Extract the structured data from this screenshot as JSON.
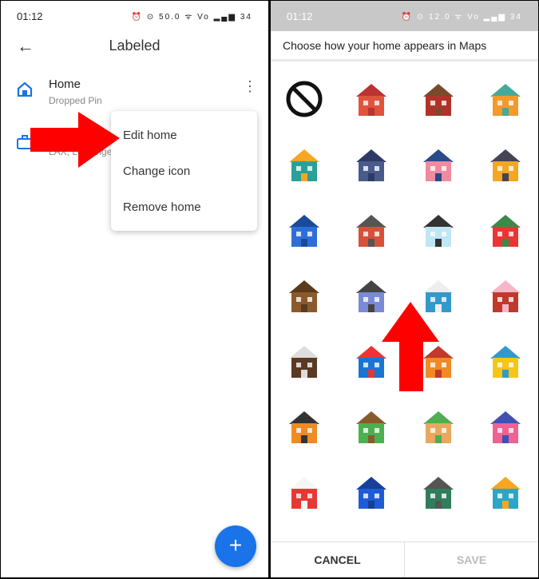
{
  "left": {
    "status": {
      "time": "01:12",
      "icons": "⏰ ⊙ 50.0 ᯤ Vo ▂▄▆ 34"
    },
    "title": "Labeled",
    "items": [
      {
        "name": "Home",
        "sub": "Dropped Pin",
        "icon": "home-icon"
      },
      {
        "name": "",
        "sub": "LAX, Los Angel",
        "icon": "briefcase-icon"
      }
    ],
    "menu": [
      "Edit home",
      "Change icon",
      "Remove home"
    ],
    "fab": "+"
  },
  "right": {
    "status": {
      "time": "01:12",
      "icons": "⏰ ⊙ 12.0 ᯤ Vo ▂▄▆ 34"
    },
    "heading": "Choose how your home appears in Maps",
    "icons": [
      {
        "name": "none",
        "c1": "#111",
        "c2": "#fff"
      },
      {
        "name": "brick-apartment",
        "c1": "#e0533c",
        "c2": "#b33"
      },
      {
        "name": "barn",
        "c1": "#b0332a",
        "c2": "#7a4b2a"
      },
      {
        "name": "orange-shop",
        "c1": "#f39a2b",
        "c2": "#4a9"
      },
      {
        "name": "camper-van",
        "c1": "#2aa198",
        "c2": "#f5a623"
      },
      {
        "name": "castle",
        "c1": "#4a5a8a",
        "c2": "#2e3a66"
      },
      {
        "name": "pink-house",
        "c1": "#f08aa0",
        "c2": "#2b4a8a"
      },
      {
        "name": "construction-crane",
        "c1": "#f5a623",
        "c2": "#445"
      },
      {
        "name": "skyscraper",
        "c1": "#2d6fd6",
        "c2": "#1a4a9a"
      },
      {
        "name": "red-house",
        "c1": "#d8503a",
        "c2": "#555"
      },
      {
        "name": "igloo",
        "c1": "#bfe6f5",
        "c2": "#333"
      },
      {
        "name": "lighthouse",
        "c1": "#e33",
        "c2": "#3a8a4a"
      },
      {
        "name": "log-cabin",
        "c1": "#8b5a2b",
        "c2": "#5a3a1a"
      },
      {
        "name": "modern-building",
        "c1": "#7a8ad6",
        "c2": "#444"
      },
      {
        "name": "modern-store",
        "c1": "#39c",
        "c2": "#eee"
      },
      {
        "name": "pagoda",
        "c1": "#c0392b",
        "c2": "#f7b6c8"
      },
      {
        "name": "pirate-ship",
        "c1": "#5a3a22",
        "c2": "#ddd"
      },
      {
        "name": "sailboat",
        "c1": "#1a75d2",
        "c2": "#e33"
      },
      {
        "name": "schoolhouse",
        "c1": "#f08a24",
        "c2": "#c0392b"
      },
      {
        "name": "submarine",
        "c1": "#f5c518",
        "c2": "#39c"
      },
      {
        "name": "teepee",
        "c1": "#f08a24",
        "c2": "#333"
      },
      {
        "name": "treehouse",
        "c1": "#4caf50",
        "c2": "#8b5a2b"
      },
      {
        "name": "adobe-house",
        "c1": "#e8a860",
        "c2": "#4caf50"
      },
      {
        "name": "pink-storefront",
        "c1": "#f06292",
        "c2": "#3f51b5"
      },
      {
        "name": "red-storefront",
        "c1": "#e53935",
        "c2": "#f5f5f5"
      },
      {
        "name": "couch",
        "c1": "#1e5bd6",
        "c2": "#163f99"
      },
      {
        "name": "tower",
        "c1": "#2e7d5b",
        "c2": "#555"
      },
      {
        "name": "dragon",
        "c1": "#2aa6c9",
        "c2": "#f5a623"
      }
    ],
    "cancel": "CANCEL",
    "save": "SAVE"
  },
  "colors": {
    "accent": "#1a73e8",
    "arrow": "#f00"
  }
}
